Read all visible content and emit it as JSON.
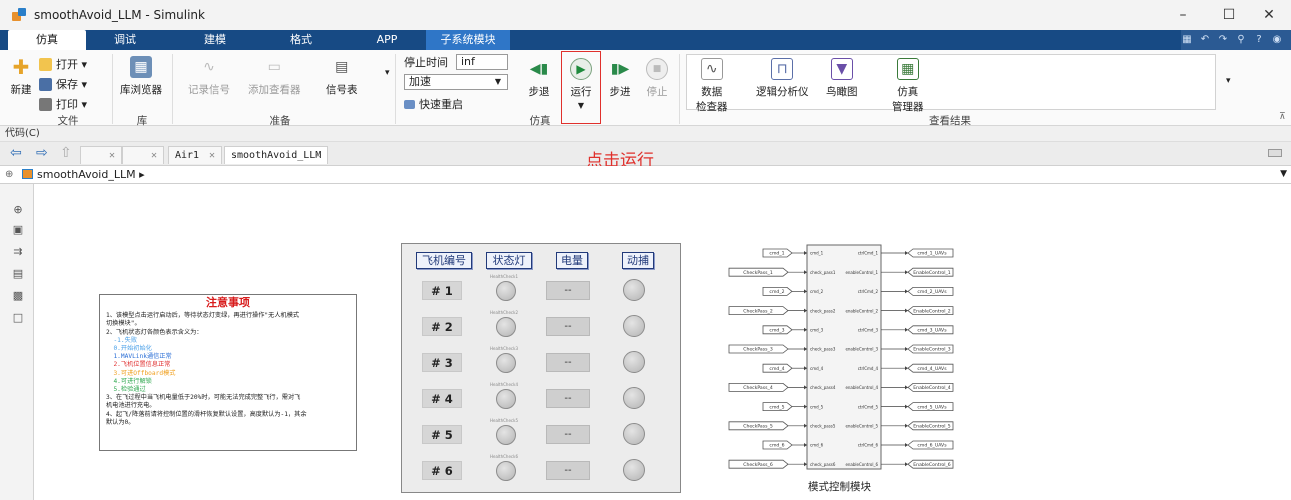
{
  "window": {
    "title": "smoothAvoid_LLM - Simulink"
  },
  "tabs": [
    "仿真",
    "调试",
    "建模",
    "格式",
    "APP",
    "子系统模块"
  ],
  "ribbon": {
    "file": {
      "new": "新建",
      "open": "打开",
      "save": "保存",
      "print": "打印",
      "label": "文件"
    },
    "library": {
      "browser": "库浏览器",
      "label": "库"
    },
    "prepare": {
      "log": "记录信号",
      "viewer": "添加查看器",
      "signal_table": "信号表",
      "label": "准备"
    },
    "simulate": {
      "stop_time_label": "停止时间",
      "stop_time": "inf",
      "mode": "加速",
      "fast_restart": "快速重启",
      "step_back": "步退",
      "run": "运行",
      "step_forward": "步进",
      "stop": "停止",
      "label": "仿真"
    },
    "results": {
      "data": "数据\n检查器",
      "logic": "逻辑分析仪",
      "bird": "鸟瞰图",
      "sim_mgr": "仿真\n管理器",
      "label": "查看结果"
    }
  },
  "codebar": "代码(C)",
  "nav": {
    "tab1": "Air1",
    "tab2": "smoothAvoid_LLM",
    "hint": "点击运行"
  },
  "breadcrumb": "smoothAvoid_LLM",
  "notes": {
    "title": "注意事项",
    "lines": [
      {
        "text": "1、该模型点击运行启动后，等待状态灯变绿，再进行操作\"无人机模式",
        "color": "#222"
      },
      {
        "text": "切换模块\"。",
        "color": "#222"
      },
      {
        "text": "2、飞机状态灯各颜色表示含义为：",
        "color": "#222"
      },
      {
        "text": "  -1.失败",
        "color": "#4aa0e8"
      },
      {
        "text": "  0.开始初始化",
        "color": "#4aa0e8"
      },
      {
        "text": "  1.MAVLink通信正常",
        "color": "#2b6fd6"
      },
      {
        "text": "  2.飞机位置信息正常",
        "color": "#e03030"
      },
      {
        "text": "  3.可进Offboard模式",
        "color": "#f0a020"
      },
      {
        "text": "  4.可进行解锁",
        "color": "#30a850"
      },
      {
        "text": "  5.检验通过",
        "color": "#30a850"
      },
      {
        "text": "3、在飞过程中当飞机电量低于20%时，可能无法完成完整飞行，需对飞",
        "color": "#222"
      },
      {
        "text": "机电池进行充电。",
        "color": "#222"
      },
      {
        "text": "4、起飞/降落前请将控制位置的滑杆恢复默认设置，高度默认为-1，其余",
        "color": "#222"
      },
      {
        "text": "默认为0。",
        "color": "#222"
      }
    ]
  },
  "panel": {
    "headers": [
      "飞机编号",
      "状态灯",
      "电量",
      "动捕"
    ],
    "rows": [
      {
        "num": "# 1",
        "lamp": "HealthCheck1",
        "battery": "--"
      },
      {
        "num": "# 2",
        "lamp": "HealthCheck2",
        "battery": "--"
      },
      {
        "num": "# 3",
        "lamp": "HealthCheck3",
        "battery": "--"
      },
      {
        "num": "# 4",
        "lamp": "HealthCheck4",
        "battery": "--"
      },
      {
        "num": "# 5",
        "lamp": "HealthCheck5",
        "battery": "--"
      },
      {
        "num": "# 6",
        "lamp": "HealthCheck6",
        "battery": "--"
      }
    ]
  },
  "subsystem": {
    "caption": "模式控制模块",
    "inputs": [
      {
        "tag": "cmd_1",
        "port": "cmd_1"
      },
      {
        "tag": "CheckPass_1",
        "port": "check_pass1"
      },
      {
        "tag": "cmd_2",
        "port": "cmd_2"
      },
      {
        "tag": "CheckPass_2",
        "port": "check_pass2"
      },
      {
        "tag": "cmd_3",
        "port": "cmd_3"
      },
      {
        "tag": "CheckPass_3",
        "port": "check_pass3"
      },
      {
        "tag": "cmd_4",
        "port": "cmd_4"
      },
      {
        "tag": "CheckPass_4",
        "port": "check_pass4"
      },
      {
        "tag": "cmd_5",
        "port": "cmd_5"
      },
      {
        "tag": "CheckPass_5",
        "port": "check_pass5"
      },
      {
        "tag": "cmd_6",
        "port": "cmd_6"
      },
      {
        "tag": "CheckPass_6",
        "port": "check_pass6"
      }
    ],
    "outputs": [
      {
        "port": "ctrlCmd_1",
        "tag": "cmd_1_UAVs"
      },
      {
        "port": "enableControl_1",
        "tag": "EnableControl_1"
      },
      {
        "port": "ctrlCmd_2",
        "tag": "cmd_2_UAVs"
      },
      {
        "port": "enableControl_2",
        "tag": "EnableControl_2"
      },
      {
        "port": "ctrlCmd_3",
        "tag": "cmd_3_UAVs"
      },
      {
        "port": "enableControl_3",
        "tag": "EnableControl_3"
      },
      {
        "port": "ctrlCmd_4",
        "tag": "cmd_4_UAVs"
      },
      {
        "port": "enableControl_4",
        "tag": "EnableControl_4"
      },
      {
        "port": "ctrlCmd_5",
        "tag": "cmd_5_UAVs"
      },
      {
        "port": "enableControl_5",
        "tag": "EnableControl_5"
      },
      {
        "port": "ctrlCmd_6",
        "tag": "cmd_6_UAVs"
      },
      {
        "port": "enableControl_6",
        "tag": "EnableControl_6"
      }
    ]
  }
}
